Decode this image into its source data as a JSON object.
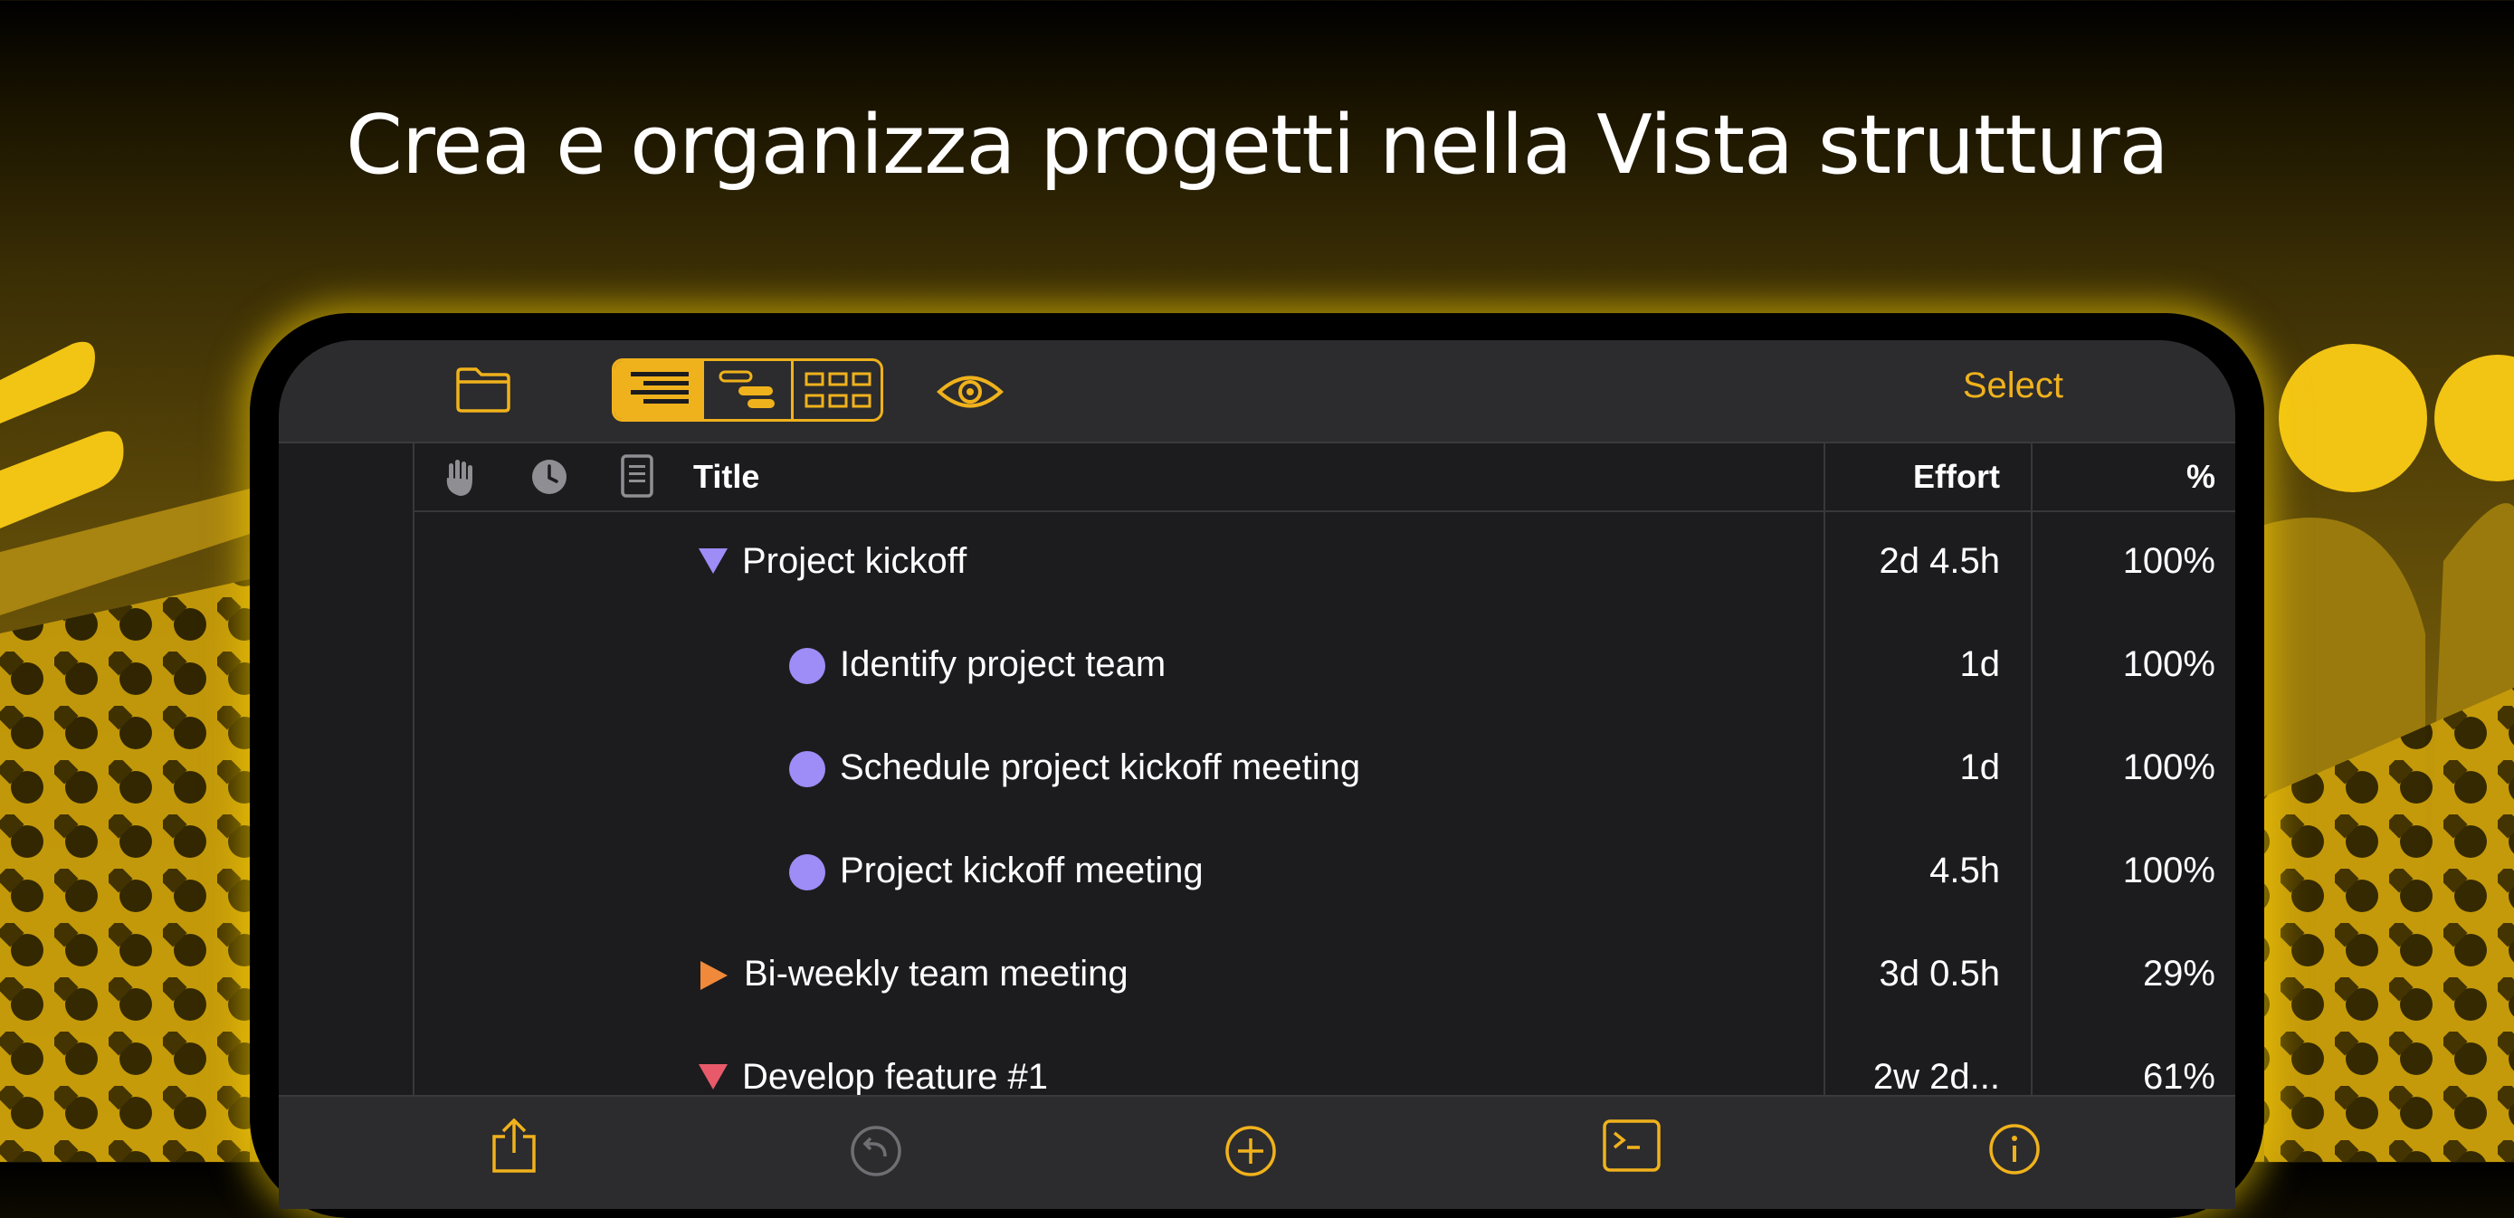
{
  "headline": "Crea e organizza progetti nella Vista struttura",
  "colors": {
    "accent": "#f0b21c",
    "group_purple": "#9e8cf7",
    "group_orange": "#f08a3a",
    "group_red": "#e85a6a"
  },
  "toolbar": {
    "folder_icon": "folder-icon",
    "view_modes": [
      "outline-view",
      "gantt-view",
      "network-view"
    ],
    "active_view": "outline-view",
    "eye_icon": "eye-icon",
    "select_label": "Select"
  },
  "table": {
    "header_icons": [
      "hand-icon",
      "clock-icon",
      "note-icon"
    ],
    "columns": {
      "title": "Title",
      "effort": "Effort",
      "pct": "%"
    },
    "rows": [
      {
        "title": "Project kickoff",
        "effort": "2d 4.5h",
        "pct": "100%",
        "kind": "group-expanded",
        "color": "#9e8cf7"
      },
      {
        "title": "Identify project team",
        "effort": "1d",
        "pct": "100%",
        "kind": "task",
        "color": "#9e8cf7"
      },
      {
        "title": "Schedule project kickoff meeting",
        "effort": "1d",
        "pct": "100%",
        "kind": "task",
        "color": "#9e8cf7"
      },
      {
        "title": "Project kickoff meeting",
        "effort": "4.5h",
        "pct": "100%",
        "kind": "task",
        "color": "#9e8cf7"
      },
      {
        "title": "Bi-weekly team meeting",
        "effort": "3d 0.5h",
        "pct": "29%",
        "kind": "group-collapsed",
        "color": "#f08a3a"
      },
      {
        "title": "Develop feature #1",
        "effort": "2w 2d...",
        "pct": "61%",
        "kind": "group-expanded",
        "color": "#e85a6a"
      }
    ]
  },
  "bottombar": {
    "icons": [
      "share-icon",
      "undo-icon",
      "add-icon",
      "terminal-icon",
      "info-icon"
    ]
  }
}
